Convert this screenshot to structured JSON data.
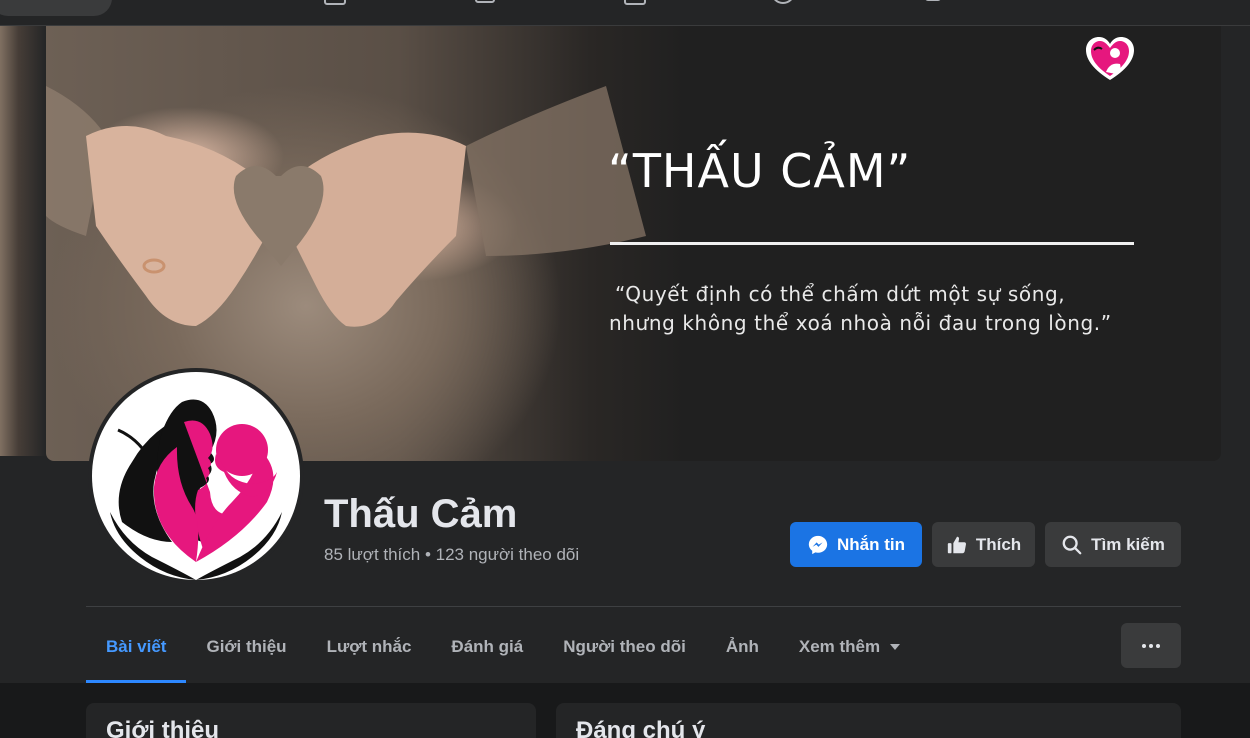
{
  "cover": {
    "quote_title": "“THẤU CẢM”",
    "quote_line_1": "“Quyết định có thể chấm dứt một sự sống,",
    "quote_line_2": "nhưng không thể xoá nhoà nỗi đau trong lòng.”"
  },
  "page": {
    "name": "Thấu Cảm",
    "stats": "85 lượt thích • 123 người theo dõi"
  },
  "actions": {
    "message_label": "Nhắn tin",
    "like_label": "Thích",
    "search_label": "Tìm kiếm"
  },
  "tabs": [
    {
      "label": "Bài viết",
      "active": true
    },
    {
      "label": "Giới thiệu"
    },
    {
      "label": "Lượt nhắc"
    },
    {
      "label": "Đánh giá"
    },
    {
      "label": "Người theo dõi"
    },
    {
      "label": "Ảnh"
    },
    {
      "label": "Xem thêm"
    }
  ],
  "cards": {
    "intro_title": "Giới thiệu",
    "featured_title": "Đáng chú ý"
  },
  "icons": {
    "message": "messenger-icon",
    "like": "thumbs-up-icon",
    "search": "search-icon",
    "more": "more-dots-icon"
  },
  "colors": {
    "accent": "#1b74e4",
    "active_tab": "#4599ff",
    "brand_pink": "#e6177e"
  }
}
